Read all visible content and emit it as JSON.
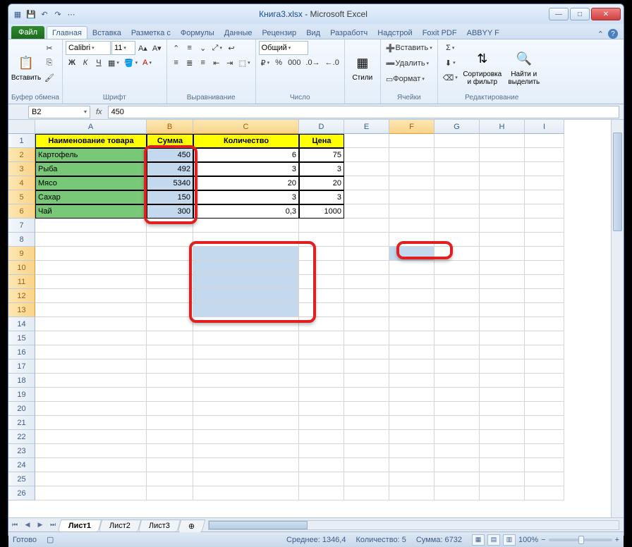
{
  "title": {
    "filename": "Книга3.xlsx",
    "app": "Microsoft Excel"
  },
  "tabs": {
    "file": "Файл",
    "list": [
      "Главная",
      "Вставка",
      "Разметка с",
      "Формулы",
      "Данные",
      "Рецензир",
      "Вид",
      "Разработч",
      "Надстрой",
      "Foxit PDF",
      "ABBYY F"
    ]
  },
  "ribbon": {
    "clipboard": {
      "paste": "Вставить",
      "label": "Буфер обмена"
    },
    "font": {
      "name": "Calibri",
      "size": "11",
      "label": "Шрифт"
    },
    "align": {
      "label": "Выравнивание"
    },
    "number": {
      "format": "Общий",
      "label": "Число"
    },
    "styles": {
      "btn": "Стили"
    },
    "cells": {
      "insert": "Вставить",
      "delete": "Удалить",
      "format": "Формат",
      "label": "Ячейки"
    },
    "editing": {
      "sort": "Сортировка и фильтр",
      "find": "Найти и выделить",
      "label": "Редактирование"
    }
  },
  "namebox": "B2",
  "formula": "450",
  "cols": [
    "A",
    "B",
    "C",
    "D",
    "E",
    "F",
    "G",
    "H",
    "I"
  ],
  "header_row": [
    "Наименование товара",
    "Сумма",
    "Количество",
    "Цена"
  ],
  "rows": [
    {
      "name": "Картофель",
      "sum": "450",
      "qty": "6",
      "price": "75"
    },
    {
      "name": "Рыба",
      "sum": "492",
      "qty": "3",
      "price": "3"
    },
    {
      "name": "Мясо",
      "sum": "5340",
      "qty": "20",
      "price": "20"
    },
    {
      "name": "Сахар",
      "sum": "150",
      "qty": "3",
      "price": "3"
    },
    {
      "name": "Чай",
      "sum": "300",
      "qty": "0,3",
      "price": "1000"
    }
  ],
  "sheets": [
    "Лист1",
    "Лист2",
    "Лист3"
  ],
  "status": {
    "ready": "Готово",
    "avg_l": "Среднее:",
    "avg_v": "1346,4",
    "cnt_l": "Количество:",
    "cnt_v": "5",
    "sum_l": "Сумма:",
    "sum_v": "6732",
    "zoom": "100%"
  }
}
